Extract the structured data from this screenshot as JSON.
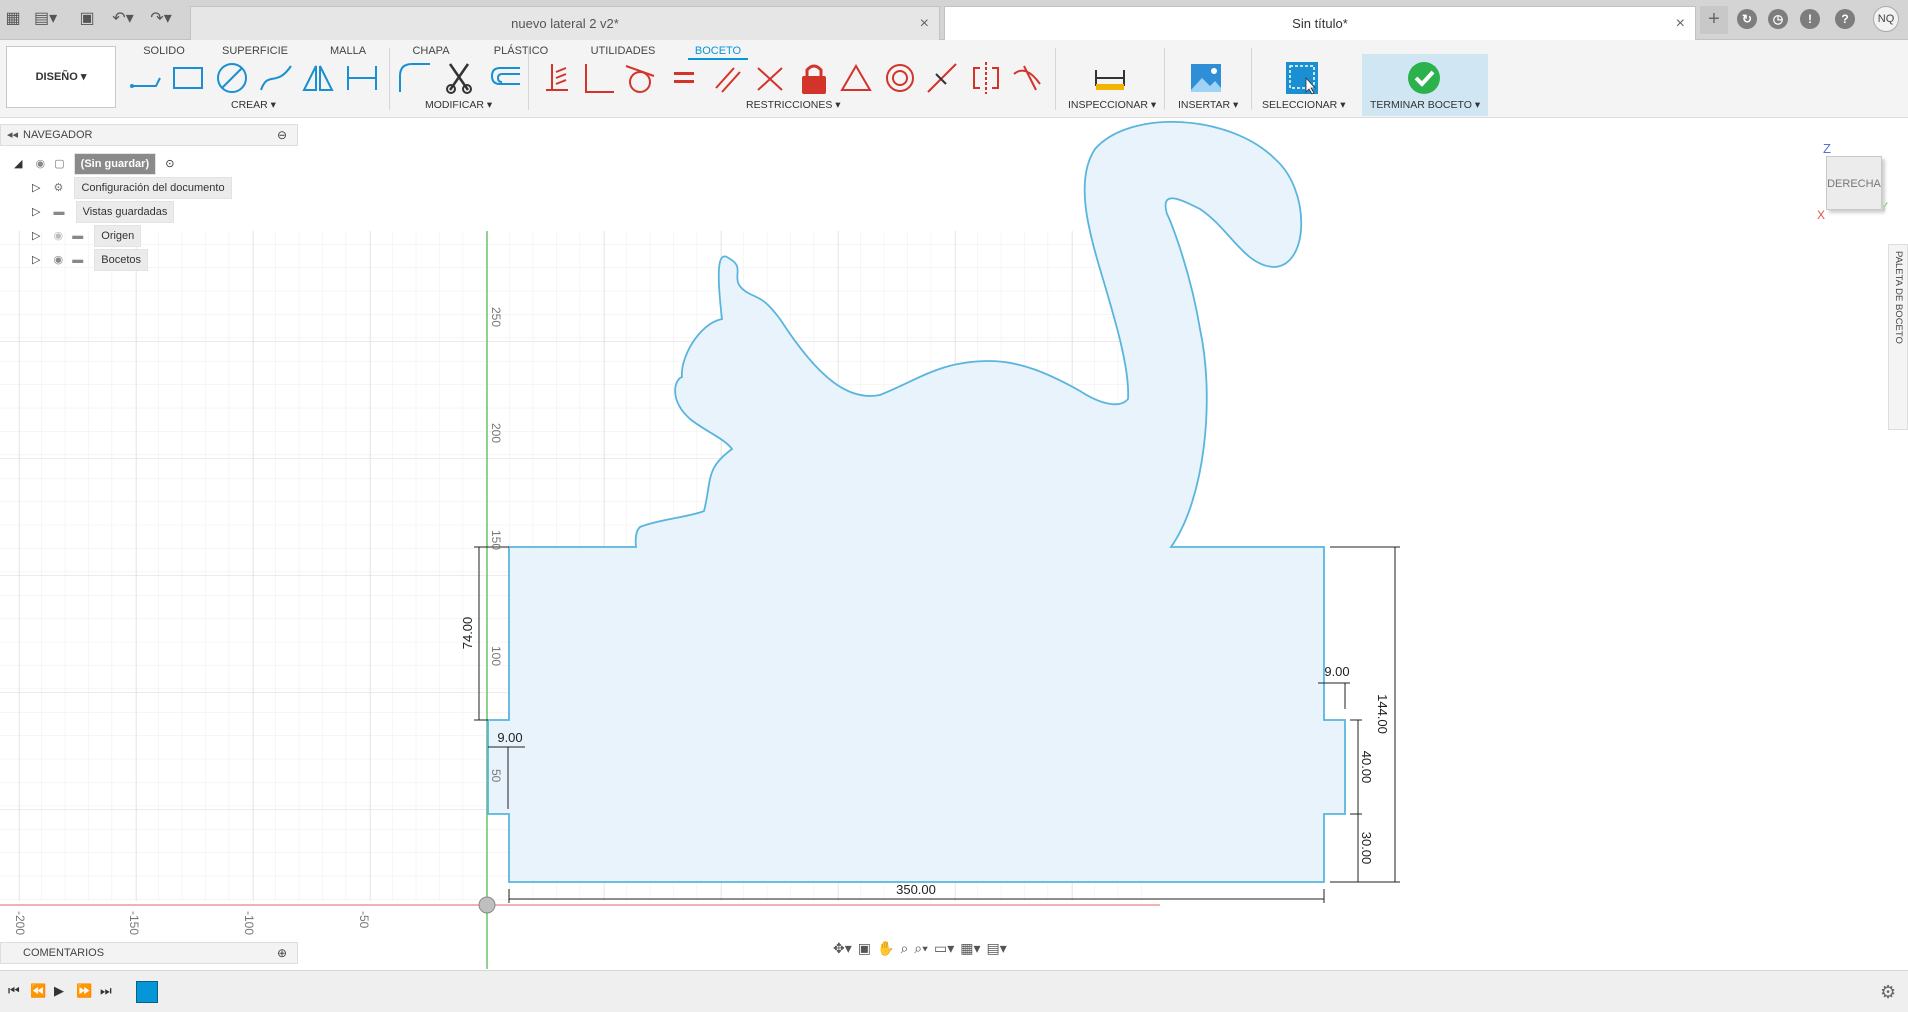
{
  "title_bar": {
    "tabs": [
      {
        "label": "nuevo lateral 2 v2*",
        "active": false
      },
      {
        "label": "Sin título*",
        "active": true
      }
    ],
    "user_initials": "NQ"
  },
  "toolbar": {
    "workspace": "DISEÑO",
    "ribbon_tabs": [
      "SOLIDO",
      "SUPERFICIE",
      "MALLA",
      "CHAPA",
      "PLÁSTICO",
      "UTILIDADES",
      "BOCETO"
    ],
    "active_ribbon_tab": "BOCETO",
    "groups": {
      "create": "CREAR",
      "modify": "MODIFICAR",
      "constraints": "RESTRICCIONES",
      "inspect": "INSPECCIONAR",
      "insert": "INSERTAR",
      "select": "SELECCIONAR",
      "finish": "TERMINAR BOCETO"
    },
    "accent_color": "#0696d7"
  },
  "navigator": {
    "header": "NAVEGADOR",
    "root": "(Sin guardar)",
    "items": [
      {
        "label": "Configuración del documento",
        "icon": "gear-icon"
      },
      {
        "label": "Vistas guardadas",
        "icon": "folder-icon"
      },
      {
        "label": "Origen",
        "icon": "folder-icon"
      },
      {
        "label": "Bocetos",
        "icon": "folder-icon"
      }
    ]
  },
  "comments": {
    "label": "COMENTARIOS"
  },
  "viewcube": {
    "face": "DERECHA",
    "axis_z": "Z",
    "axis_x": "X",
    "axis_y": "Y"
  },
  "palette": {
    "label": "PALETA DE BOCETO"
  },
  "canvas": {
    "vertical_scale": [
      "250",
      "200",
      "150",
      "100",
      "50"
    ],
    "horizontal_scale": [
      "-200",
      "-150",
      "-100",
      "-50"
    ],
    "dimensions": {
      "width": "350.00",
      "total_height": "144.00",
      "left_height": "74.00",
      "left_notch": "9.00",
      "right_notch": "9.00",
      "right_slot": "40.00",
      "right_bottom": "30.00"
    },
    "sketch_fill": "#e9f3fb",
    "sketch_stroke": "#5ab5de"
  }
}
